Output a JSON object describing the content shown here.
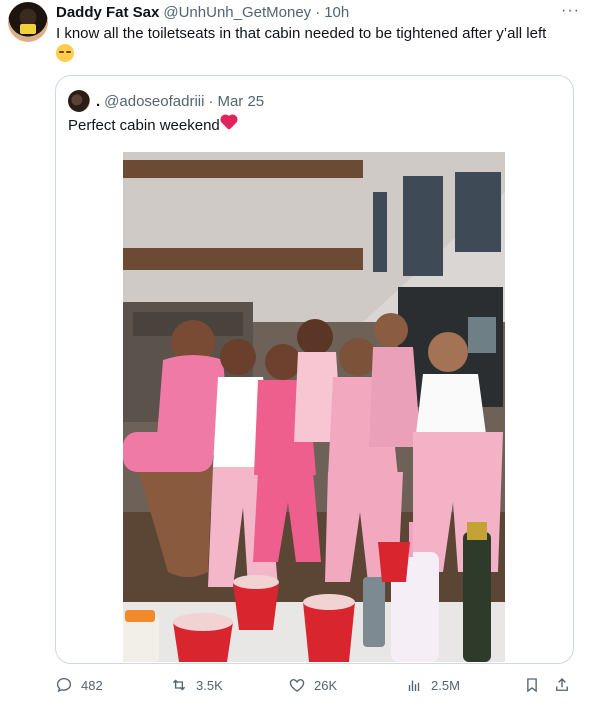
{
  "tweet": {
    "author_name": "Daddy Fat Sax",
    "author_handle": "@UnhUnh_GetMoney",
    "separator": "·",
    "time": "10h",
    "more_icon": "more-horizontal-icon",
    "text": "I know all the toiletseats in that cabin needed to be tightened after y’all left",
    "emoji": "relieved-face-emoji"
  },
  "quote": {
    "display_name": ".",
    "handle": "@adoseofadriii",
    "separator": "·",
    "date": "Mar 25",
    "text": "Perfect cabin weekend",
    "emoji": "two-hearts-emoji",
    "photo": "group-photo-cabin-pink-pajamas"
  },
  "actions": {
    "replies": "482",
    "retweets": "3.5K",
    "likes": "26K",
    "views": "2.5M",
    "reply_icon": "reply-icon",
    "retweet_icon": "retweet-icon",
    "like_icon": "heart-icon",
    "views_icon": "analytics-icon",
    "bookmark_icon": "bookmark-icon",
    "share_icon": "share-icon"
  },
  "colors": {
    "text_primary": "#0f1419",
    "text_secondary": "#536471",
    "border": "#cfd9de"
  }
}
